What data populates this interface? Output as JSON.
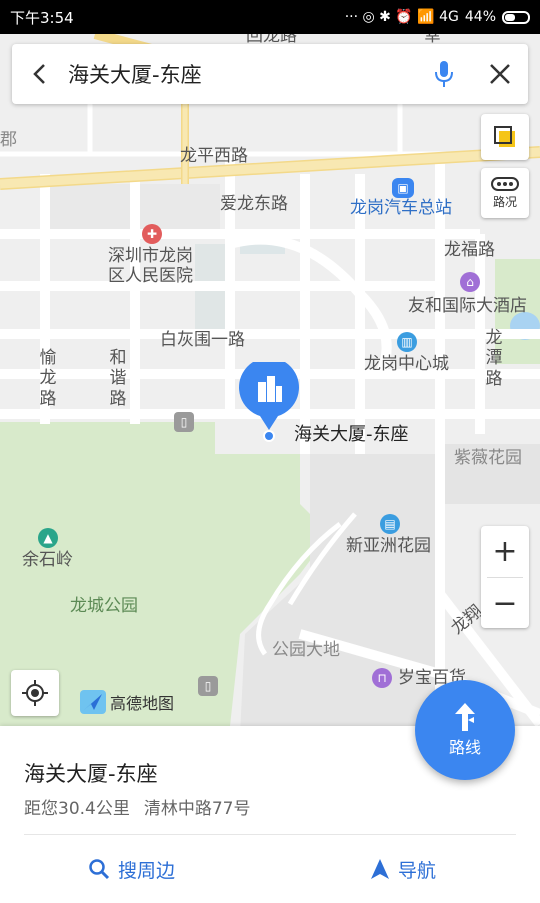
{
  "status_bar": {
    "time": "下午3:54",
    "icons": "··· ◎ ✱ ⏰ 📶 4G",
    "battery": "44%"
  },
  "search": {
    "query": "海关大厦-东座",
    "back_icon": "back-arrow-icon",
    "mic_icon": "microphone-icon",
    "close_icon": "close-icon"
  },
  "map": {
    "labels": {
      "top_road": "回龙路",
      "top_right_road": "幸",
      "left_edge": "郡",
      "longping_west": "龙平西路",
      "ailong_east": "爱龙东路",
      "bus_station": "龙岗汽车总站",
      "hospital": "深圳市龙岗区人民医院",
      "longfu": "龙福路",
      "youhe_hotel": "友和国际大酒店",
      "baihuiwei": "白灰围一路",
      "yulong": "愉龙路",
      "hexie": "和谐路",
      "longgang_center": "龙岗中心城",
      "longtan": "龙潭路",
      "marker_name": "海关大厦-东座",
      "ziwei": "紫薇花园",
      "xinyazhou": "新亚洲花园",
      "yushiling": "余石岭",
      "longcheng_park": "龙城公园",
      "longxiang": "龙翔",
      "park_land": "公园大地",
      "suibao": "岁宝百货"
    },
    "traffic_label": "路况",
    "zoom_in": "+",
    "zoom_out": "−",
    "logo_text": "高德地图"
  },
  "route_button": {
    "label": "路线"
  },
  "place": {
    "name": "海关大厦-东座",
    "distance": "距您30.4公里",
    "address": "清林中路77号"
  },
  "actions": {
    "nearby": "搜周边",
    "navigate": "导航"
  },
  "colors": {
    "accent": "#3b86f0",
    "link": "#2d6fd6",
    "park": "#d8eacb",
    "road_major": "#f6e6a6"
  }
}
